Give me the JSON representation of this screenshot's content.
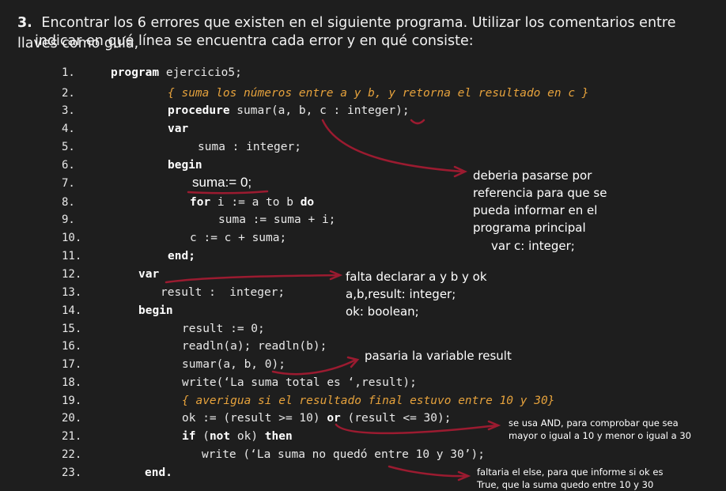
{
  "question": {
    "number": "3.",
    "text_line1": "Encontrar los 6 errores que existen en el siguiente programa. Utilizar los comentarios entre llaves como guía,",
    "text_line2": "indicar en qué línea se encuentra cada error y en qué consiste:"
  },
  "line_numbers": [
    "1.",
    "2.",
    "3.",
    "4.",
    "5.",
    "6.",
    "7.",
    "8.",
    "9.",
    "10.",
    "11.",
    "12.",
    "13.",
    "14.",
    "15.",
    "16.",
    "17.",
    "18.",
    "19.",
    "20.",
    "21.",
    "22.",
    "23."
  ],
  "code": {
    "l1_kw": "program",
    "l1_rest": " ejercicio5;",
    "l2": "{ suma los números entre a y b, y retorna el resultado en c }",
    "l3_kw": "procedure",
    "l3_rest": " sumar(a, b, c : integer);",
    "l4": "var",
    "l5": "suma : integer;",
    "l6": "begin",
    "l7_handwritten": "suma:= 0;",
    "l8_kw1": "for",
    "l8_mid": " i := a to b ",
    "l8_kw2": "do",
    "l9": "suma := suma + i;",
    "l10": "c := c + suma;",
    "l11": "end;",
    "l12": "var",
    "l13": "result :  integer;",
    "l14": "begin",
    "l15": "result := 0;",
    "l16": "readln(a); readln(b);",
    "l17": "sumar(a, b, 0);",
    "l18": "write(‘La suma total es ‘,result);",
    "l19": "{ averigua si el resultado final estuvo entre 10 y 30}",
    "l20_a": "ok := (result >= 10) ",
    "l20_kw": "or",
    "l20_b": " (result <= 30);",
    "l21_kw1": "if",
    "l21_a": " (",
    "l21_kw2": "not",
    "l21_b": " ok) ",
    "l21_kw3": "then",
    "l22": "write (‘La suma no quedó entre 10 y 30’);",
    "l23": "end."
  },
  "annotations": {
    "note1": [
      "deberia pasarse por",
      "referencia para que se",
      "pueda informar en el",
      "programa principal"
    ],
    "note1_code": "var c: integer;",
    "note2": [
      "falta declarar a y b  y ok",
      "a,b,result: integer;",
      "ok: boolean;"
    ],
    "note3": "pasaria la variable result",
    "note4": [
      "se usa AND, para comprobar que sea",
      "mayor o igual a 10 y menor o igual a 30"
    ],
    "note5": [
      "faltaria el else, para que informe si ok es",
      "True, que la suma quedo entre 10 y 30"
    ]
  },
  "colors": {
    "background": "#1e1e1e",
    "comment": "#e6a23c",
    "ink": "#9b1b30"
  }
}
